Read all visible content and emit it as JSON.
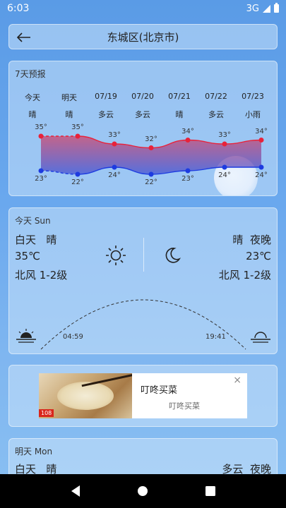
{
  "status": {
    "time": "6:03",
    "network": "3G"
  },
  "header": {
    "title": "东城区(北京市)"
  },
  "forecast": {
    "title": "7天预报",
    "days": [
      {
        "day": "今天",
        "cond": "晴",
        "high": 35,
        "low": 23
      },
      {
        "day": "明天",
        "cond": "晴",
        "high": 35,
        "low": 22
      },
      {
        "day": "07/19",
        "cond": "多云",
        "high": 33,
        "low": 24
      },
      {
        "day": "07/20",
        "cond": "多云",
        "high": 32,
        "low": 22
      },
      {
        "day": "07/21",
        "cond": "晴",
        "high": 34,
        "low": 23
      },
      {
        "day": "07/22",
        "cond": "多云",
        "high": 33,
        "low": 24
      },
      {
        "day": "07/23",
        "cond": "小雨",
        "high": 34,
        "low": 24
      }
    ],
    "high_labels": [
      "35°",
      "35°",
      "33°",
      "32°",
      "34°",
      "33°",
      "34°"
    ],
    "low_labels": [
      "23°",
      "22°",
      "24°",
      "22°",
      "23°",
      "24°",
      "24°"
    ],
    "colors": {
      "high": "#e8223a",
      "low": "#1d3be0"
    }
  },
  "today": {
    "title": "今天  Sun",
    "day_label": "白天",
    "day_cond": "晴",
    "day_temp": "35℃",
    "day_wind": "北风  1-2级",
    "night_label": "夜晚",
    "night_cond": "晴",
    "night_temp": "23℃",
    "night_wind": "北风  1-2级",
    "sunrise": "04:59",
    "sunset": "19:41"
  },
  "ad": {
    "name": "叮咚买菜",
    "subtitle": "叮咚买菜",
    "close": "×",
    "badge": "108"
  },
  "tomorrow": {
    "title": "明天  Mon",
    "day_label": "白天",
    "day_cond": "晴",
    "night_cond": "多云",
    "night_label": "夜晚"
  }
}
